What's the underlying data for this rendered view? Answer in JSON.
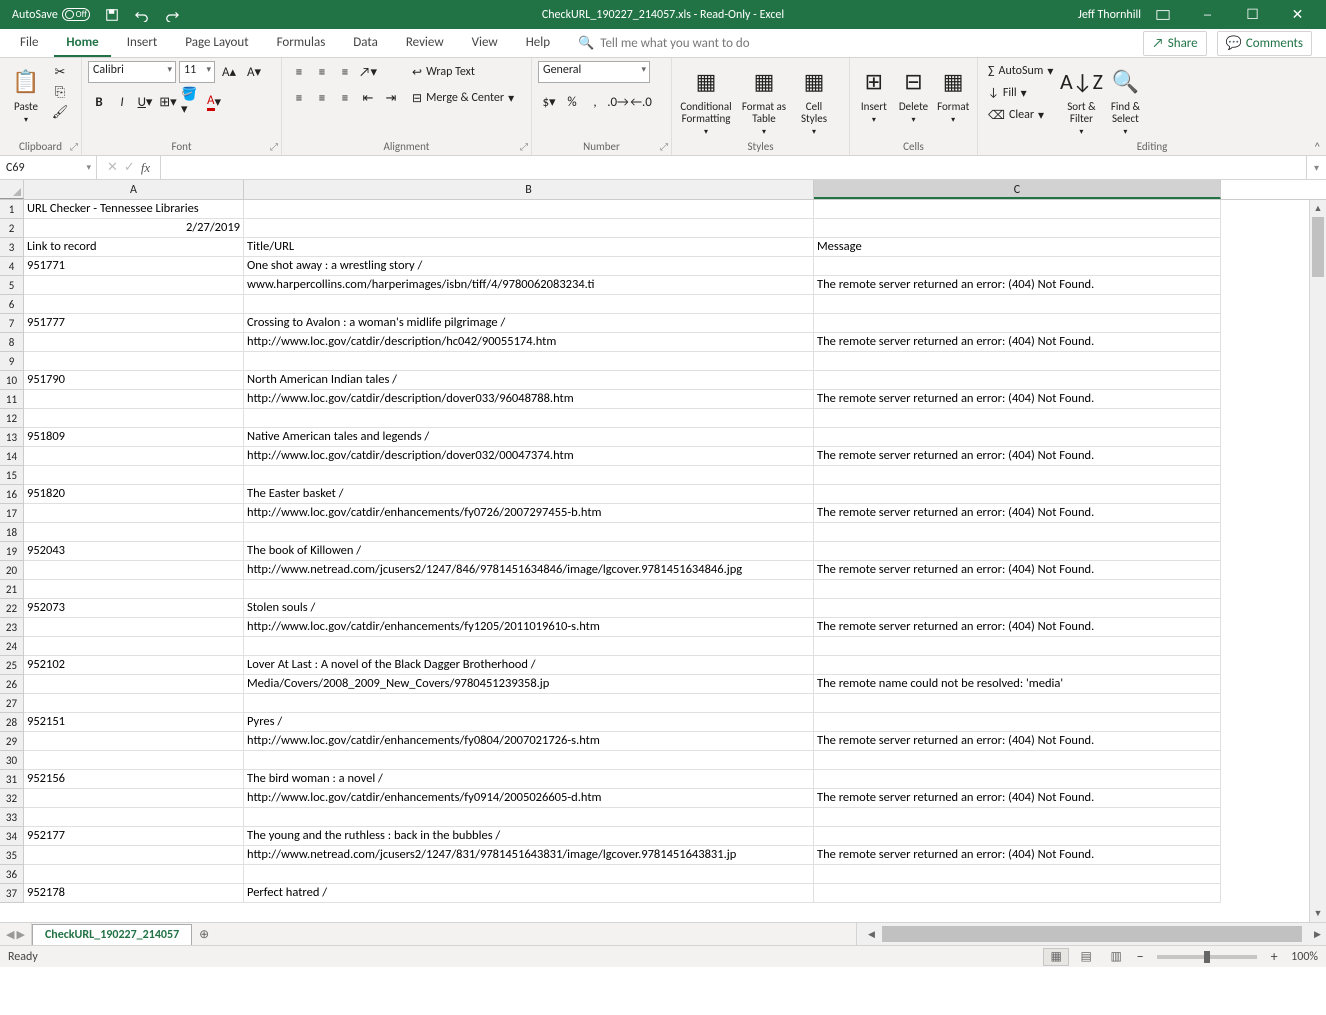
{
  "titlebar": {
    "autosave_label": "AutoSave",
    "autosave_state": "Off",
    "doc_title": "CheckURL_190227_214057.xls  -  Read-Only  -  Excel",
    "user": "Jeff Thornhill"
  },
  "menu": {
    "tabs": [
      "File",
      "Home",
      "Insert",
      "Page Layout",
      "Formulas",
      "Data",
      "Review",
      "View",
      "Help"
    ],
    "active": "Home",
    "tell_me": "Tell me what you want to do",
    "share": "Share",
    "comments": "Comments"
  },
  "ribbon": {
    "clipboard": {
      "paste": "Paste",
      "label": "Clipboard"
    },
    "font": {
      "name": "Calibri",
      "size": "11",
      "label": "Font"
    },
    "alignment": {
      "wrap": "Wrap Text",
      "merge": "Merge & Center",
      "label": "Alignment"
    },
    "number": {
      "format": "General",
      "label": "Number"
    },
    "styles": {
      "cond": "Conditional Formatting",
      "table": "Format as Table",
      "cell": "Cell Styles",
      "label": "Styles"
    },
    "cells": {
      "insert": "Insert",
      "delete": "Delete",
      "format": "Format",
      "label": "Cells"
    },
    "editing": {
      "autosum": "AutoSum",
      "fill": "Fill",
      "clear": "Clear",
      "sort": "Sort & Filter",
      "find": "Find & Select",
      "label": "Editing"
    }
  },
  "namebox": "C69",
  "formula": "",
  "columns": [
    "A",
    "B",
    "C"
  ],
  "selected_col": "C",
  "col_widths": {
    "A": 220,
    "B": 570,
    "C": 407
  },
  "rows": [
    {
      "n": 1,
      "A": "URL Checker - Tennessee Libraries",
      "B": "",
      "C": ""
    },
    {
      "n": 2,
      "A": "2/27/2019",
      "A_align": "right",
      "B": "",
      "C": ""
    },
    {
      "n": 3,
      "A": "Link to record",
      "B": "Title/URL",
      "C": "Message"
    },
    {
      "n": 4,
      "A": "951771",
      "B": "One shot away : a wrestling story /",
      "C": ""
    },
    {
      "n": 5,
      "A": "",
      "B": "www.harpercollins.com/harperimages/isbn/tiff/4/9780062083234.ti",
      "C": "The remote server returned an error: (404) Not Found."
    },
    {
      "n": 6,
      "A": "",
      "B": "",
      "C": ""
    },
    {
      "n": 7,
      "A": "951777",
      "B": "Crossing to Avalon : a woman's midlife pilgrimage /",
      "C": ""
    },
    {
      "n": 8,
      "A": "",
      "B": "http://www.loc.gov/catdir/description/hc042/90055174.htm",
      "C": "The remote server returned an error: (404) Not Found."
    },
    {
      "n": 9,
      "A": "",
      "B": "",
      "C": ""
    },
    {
      "n": 10,
      "A": "951790",
      "B": "North American Indian tales /",
      "C": ""
    },
    {
      "n": 11,
      "A": "",
      "B": "http://www.loc.gov/catdir/description/dover033/96048788.htm",
      "C": "The remote server returned an error: (404) Not Found."
    },
    {
      "n": 12,
      "A": "",
      "B": "",
      "C": ""
    },
    {
      "n": 13,
      "A": "951809",
      "B": "Native American tales and legends /",
      "C": ""
    },
    {
      "n": 14,
      "A": "",
      "B": "http://www.loc.gov/catdir/description/dover032/00047374.htm",
      "C": "The remote server returned an error: (404) Not Found."
    },
    {
      "n": 15,
      "A": "",
      "B": "",
      "C": ""
    },
    {
      "n": 16,
      "A": "951820",
      "B": "The Easter basket /",
      "C": ""
    },
    {
      "n": 17,
      "A": "",
      "B": "http://www.loc.gov/catdir/enhancements/fy0726/2007297455-b.htm",
      "C": "The remote server returned an error: (404) Not Found."
    },
    {
      "n": 18,
      "A": "",
      "B": "",
      "C": ""
    },
    {
      "n": 19,
      "A": "952043",
      "B": "The book of Killowen /",
      "C": ""
    },
    {
      "n": 20,
      "A": "",
      "B": "http://www.netread.com/jcusers2/1247/846/9781451634846/image/lgcover.9781451634846.jpg",
      "C": "The remote server returned an error: (404) Not Found."
    },
    {
      "n": 21,
      "A": "",
      "B": "",
      "C": ""
    },
    {
      "n": 22,
      "A": "952073",
      "B": "Stolen souls /",
      "C": ""
    },
    {
      "n": 23,
      "A": "",
      "B": "http://www.loc.gov/catdir/enhancements/fy1205/2011019610-s.htm",
      "C": "The remote server returned an error: (404) Not Found."
    },
    {
      "n": 24,
      "A": "",
      "B": "",
      "C": ""
    },
    {
      "n": 25,
      "A": "952102",
      "B": "Lover At Last : A novel of the Black Dagger Brotherhood /",
      "C": ""
    },
    {
      "n": 26,
      "A": "",
      "B": "Media/Covers/2008_2009_New_Covers/9780451239358.jp",
      "C": "The remote name could not be resolved: 'media'"
    },
    {
      "n": 27,
      "A": "",
      "B": "",
      "C": ""
    },
    {
      "n": 28,
      "A": "952151",
      "B": "Pyres /",
      "C": ""
    },
    {
      "n": 29,
      "A": "",
      "B": "http://www.loc.gov/catdir/enhancements/fy0804/2007021726-s.htm",
      "C": "The remote server returned an error: (404) Not Found."
    },
    {
      "n": 30,
      "A": "",
      "B": "",
      "C": ""
    },
    {
      "n": 31,
      "A": "952156",
      "B": "The bird woman : a novel /",
      "C": ""
    },
    {
      "n": 32,
      "A": "",
      "B": "http://www.loc.gov/catdir/enhancements/fy0914/2005026605-d.htm",
      "C": "The remote server returned an error: (404) Not Found."
    },
    {
      "n": 33,
      "A": "",
      "B": "",
      "C": ""
    },
    {
      "n": 34,
      "A": "952177",
      "B": "The young and the ruthless : back in the bubbles /",
      "C": ""
    },
    {
      "n": 35,
      "A": "",
      "B": "http://www.netread.com/jcusers2/1247/831/9781451643831/image/lgcover.9781451643831.jp",
      "C": "The remote server returned an error: (404) Not Found."
    },
    {
      "n": 36,
      "A": "",
      "B": "",
      "C": ""
    },
    {
      "n": 37,
      "A": "952178",
      "B": "Perfect hatred /",
      "C": ""
    }
  ],
  "sheet_tab": "CheckURL_190227_214057",
  "status": {
    "ready": "Ready",
    "zoom": "100%"
  }
}
